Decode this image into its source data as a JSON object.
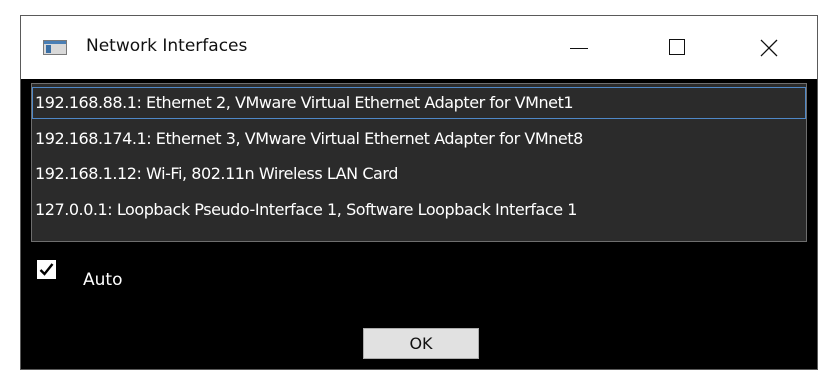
{
  "window": {
    "title": "Network Interfaces",
    "icon": "app-window-icon",
    "controls": {
      "minimize_icon": "minimize-icon",
      "maximize_icon": "maximize-icon",
      "close_icon": "close-icon"
    }
  },
  "interfaces": {
    "selected_index": 0,
    "items": [
      {
        "label": "192.168.88.1: Ethernet 2, VMware Virtual Ethernet Adapter for VMnet1"
      },
      {
        "label": "192.168.174.1: Ethernet 3, VMware Virtual Ethernet Adapter for VMnet8"
      },
      {
        "label": "192.168.1.12: Wi-Fi, 802.11n Wireless LAN Card"
      },
      {
        "label": "127.0.0.1: Loopback Pseudo-Interface 1, Software Loopback Interface 1"
      }
    ]
  },
  "auto": {
    "label": "Auto",
    "checked": true
  },
  "ok_button": {
    "label": "OK"
  },
  "colors": {
    "window_background": "#000000",
    "list_background": "#2b2b2b",
    "selection_border": "#4f88c7",
    "button_background": "#e1e1e1"
  }
}
